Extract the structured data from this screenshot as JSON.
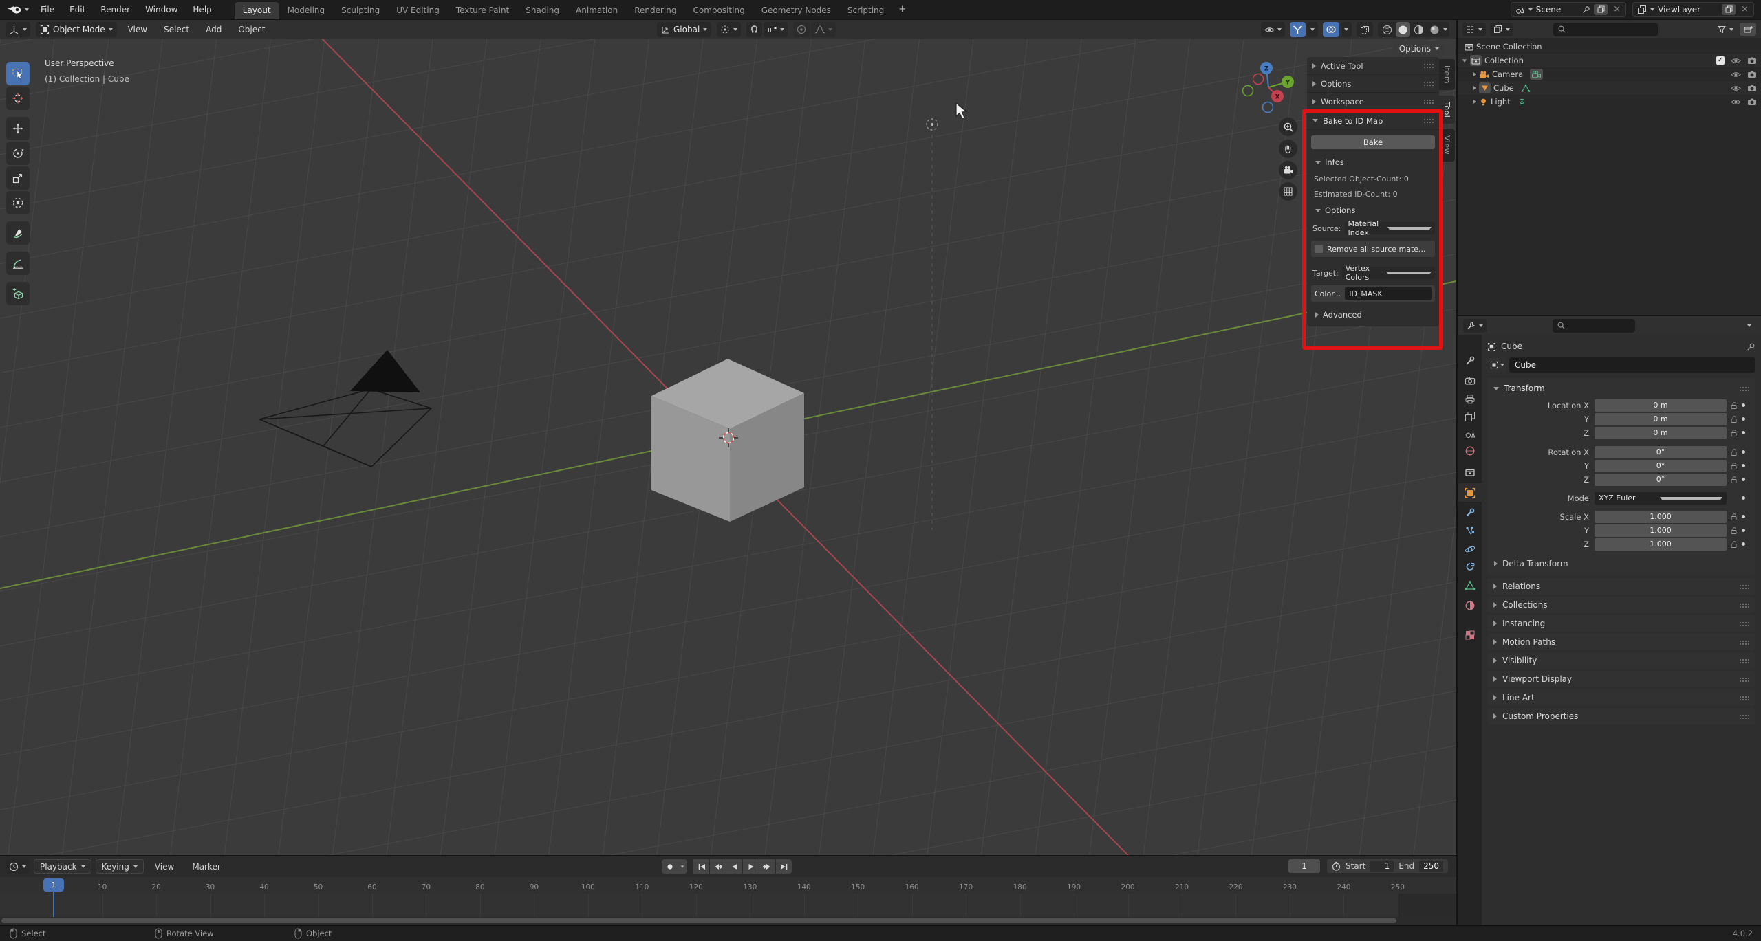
{
  "colors": {
    "accent_blue": "#4772b3",
    "annotation_red": "#e21212",
    "object_orange": "#e8973e",
    "data_green": "#56be8e"
  },
  "topbar": {
    "menus": [
      "File",
      "Edit",
      "Render",
      "Window",
      "Help"
    ],
    "workspace_tabs": [
      {
        "label": "Layout",
        "active": true
      },
      {
        "label": "Modeling"
      },
      {
        "label": "Sculpting"
      },
      {
        "label": "UV Editing"
      },
      {
        "label": "Texture Paint"
      },
      {
        "label": "Shading"
      },
      {
        "label": "Animation"
      },
      {
        "label": "Rendering"
      },
      {
        "label": "Compositing"
      },
      {
        "label": "Geometry Nodes"
      },
      {
        "label": "Scripting"
      }
    ],
    "new_tab_label": "+",
    "scene_label": "Scene",
    "view_layer_label": "ViewLayer"
  },
  "viewport": {
    "header": {
      "mode": "Object Mode",
      "menus": [
        "View",
        "Select",
        "Add",
        "Object"
      ],
      "orientation": "Global"
    },
    "tool_settings_label": "Options",
    "overlay": {
      "line1": "User Perspective",
      "line2": "(1) Collection | Cube"
    },
    "gizmo": {
      "x": "X",
      "y": "Y",
      "z": "Z"
    }
  },
  "sidebar": {
    "tabs": [
      {
        "label": "Item"
      },
      {
        "label": "Tool",
        "active": true
      },
      {
        "label": "View"
      }
    ],
    "collapsed_sections": [
      "Active Tool",
      "Options",
      "Workspace"
    ],
    "bake_panel": {
      "title": "Bake to ID Map",
      "bake_button": "Bake",
      "infos_title": "Infos",
      "selected_count": "Selected Object-Count: 0",
      "estimated_count": "Estimated ID-Count: 0",
      "options_title": "Options",
      "source_label": "Source:",
      "source_value": "Material Index",
      "remove_checkbox_label": "Remove all source mate...",
      "target_label": "Target:",
      "target_value": "Vertex Colors",
      "color_label": "Color...",
      "color_value": "ID_MASK",
      "advanced_label": "Advanced"
    }
  },
  "outliner": {
    "items": [
      {
        "label": "Scene Collection",
        "type": "scene-collection"
      },
      {
        "label": "Collection",
        "type": "collection"
      },
      {
        "label": "Camera",
        "type": "camera"
      },
      {
        "label": "Cube",
        "type": "mesh"
      },
      {
        "label": "Light",
        "type": "light"
      }
    ]
  },
  "properties": {
    "breadcrumb": "Cube",
    "name_field": "Cube",
    "transform": {
      "title": "Transform",
      "rows": [
        {
          "label": "Location X",
          "value": "0 m"
        },
        {
          "label": "Y",
          "value": "0 m"
        },
        {
          "label": "Z",
          "value": "0 m"
        },
        {
          "label": "Rotation X",
          "value": "0°"
        },
        {
          "label": "Y",
          "value": "0°"
        },
        {
          "label": "Z",
          "value": "0°"
        }
      ],
      "mode_label": "Mode",
      "mode_value": "XYZ Euler",
      "scale_rows": [
        {
          "label": "Scale X",
          "value": "1.000"
        },
        {
          "label": "Y",
          "value": "1.000"
        },
        {
          "label": "Z",
          "value": "1.000"
        }
      ],
      "delta_label": "Delta Transform"
    },
    "panels": [
      "Relations",
      "Collections",
      "Instancing",
      "Motion Paths",
      "Visibility",
      "Viewport Display",
      "Line Art",
      "Custom Properties"
    ],
    "tabs": [
      {
        "name": "tool"
      },
      {
        "name": "render"
      },
      {
        "name": "output"
      },
      {
        "name": "view-layer"
      },
      {
        "name": "scene"
      },
      {
        "name": "world"
      },
      {
        "name": "collection"
      },
      {
        "name": "object",
        "active": true
      },
      {
        "name": "modifiers"
      },
      {
        "name": "particles"
      },
      {
        "name": "physics"
      },
      {
        "name": "constraints"
      },
      {
        "name": "data"
      },
      {
        "name": "material"
      },
      {
        "name": "texture"
      }
    ]
  },
  "timeline": {
    "menus": [
      "Playback",
      "Keying",
      "View",
      "Marker"
    ],
    "current_frame": "1",
    "start_label": "Start",
    "start_value": "1",
    "end_label": "End",
    "end_value": "250",
    "ruler_ticks": [
      10,
      20,
      30,
      40,
      50,
      60,
      70,
      80,
      90,
      100,
      110,
      120,
      130,
      140,
      150,
      160,
      170,
      180,
      190,
      200,
      210,
      220,
      230,
      240,
      250
    ]
  },
  "statusbar": {
    "items": [
      "Select",
      "Rotate View",
      "Object"
    ],
    "version": "4.0.2"
  }
}
